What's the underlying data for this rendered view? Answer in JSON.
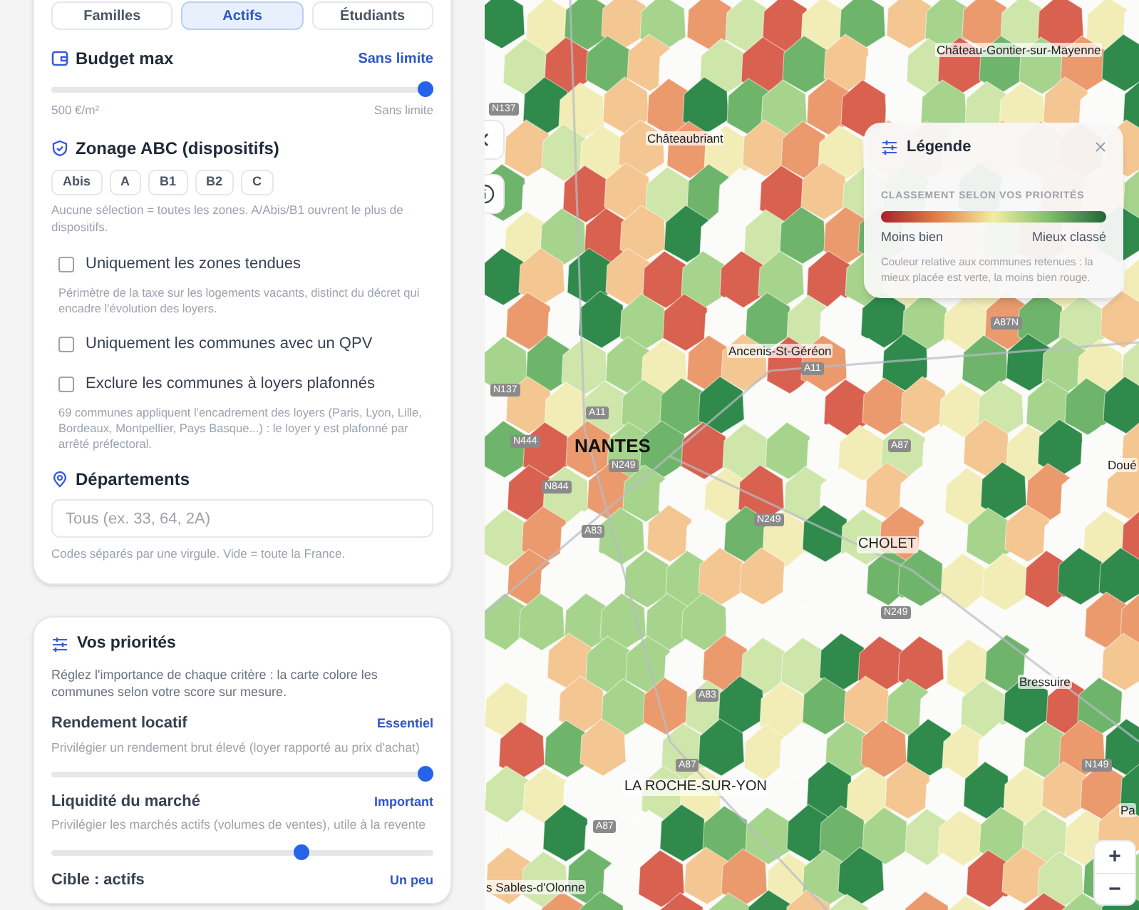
{
  "profile_tabs": [
    {
      "label": "Familles",
      "selected": false
    },
    {
      "label": "Actifs",
      "selected": true
    },
    {
      "label": "Étudiants",
      "selected": false
    }
  ],
  "budget": {
    "title": "Budget max",
    "value": "Sans limite",
    "level": 1,
    "min_label": "500 €/m²",
    "max_label": "Sans limite"
  },
  "zonage": {
    "title": "Zonage ABC (dispositifs)",
    "chips": [
      {
        "label": "Abis",
        "selected": false
      },
      {
        "label": "A",
        "selected": false
      },
      {
        "label": "B1",
        "selected": false
      },
      {
        "label": "B2",
        "selected": false
      },
      {
        "label": "C",
        "selected": false
      }
    ],
    "hint": "Aucune sélection = toutes les zones. A/Abis/B1 ouvrent le plus de dispositifs."
  },
  "filters": [
    {
      "label": "Uniquement les zones tendues",
      "checked": false,
      "hint": "Périmètre de la taxe sur les logements vacants, distinct du décret qui encadre l'évolution des loyers."
    },
    {
      "label": "Uniquement les communes avec un QPV",
      "checked": false
    },
    {
      "label": "Exclure les communes à loyers plafonnés",
      "checked": false,
      "hint": "69 communes appliquent l'encadrement des loyers (Paris, Lyon, Lille, Bordeaux, Montpellier, Pays Basque...) : le loyer y est plafonné par arrêté préfectoral."
    }
  ],
  "departements": {
    "title": "Départements",
    "placeholder": "Tous (ex. 33, 64, 2A)",
    "hint": "Codes séparés par une virgule. Vide = toute la France."
  },
  "priorities": {
    "title": "Vos priorités",
    "intro": "Réglez l'importance de chaque critère : la carte colore les communes selon votre score sur mesure.",
    "criteria": [
      {
        "name": "Rendement locatif",
        "weight": "Essentiel",
        "description": "Privilégier un rendement brut élevé (loyer rapporté au prix d'achat)",
        "level": 1
      },
      {
        "name": "Liquidité du marché",
        "weight": "Important",
        "description": "Privilégier les marchés actifs (volumes de ventes), utile à la revente",
        "level": 0.66
      },
      {
        "name": "Cible : actifs",
        "weight": "Un peu"
      }
    ]
  },
  "legend": {
    "title": "Légende",
    "section": "CLASSEMENT SELON VOS PRIORITÉS",
    "low_label": "Moins bien",
    "high_label": "Mieux classé",
    "note": "Couleur relative aux communes retenues : la mieux placée est verte, la moins bien rouge."
  },
  "map_labels": [
    {
      "text": "Château-Gontier-sur-Mayenne",
      "kind": "town"
    },
    {
      "text": "Châteaubriant",
      "kind": "town"
    },
    {
      "text": "Ancenis-St-Géréon",
      "kind": "town"
    },
    {
      "text": "NANTES",
      "kind": "major"
    },
    {
      "text": "CHOLET",
      "kind": "city"
    },
    {
      "text": "Bressuire",
      "kind": "town"
    },
    {
      "text": "LA ROCHE-SUR-YON",
      "kind": "city"
    },
    {
      "text": "s Sables-d'Olonne",
      "kind": "town"
    },
    {
      "text": "Doué",
      "kind": "town"
    },
    {
      "text": "Pa",
      "kind": "town"
    },
    {
      "text": "N137",
      "kind": "road"
    },
    {
      "text": "A11",
      "kind": "road"
    },
    {
      "text": "N137",
      "kind": "road"
    },
    {
      "text": "A11",
      "kind": "road"
    },
    {
      "text": "N444",
      "kind": "road"
    },
    {
      "text": "N249",
      "kind": "road"
    },
    {
      "text": "N844",
      "kind": "road"
    },
    {
      "text": "A83",
      "kind": "road"
    },
    {
      "text": "N249",
      "kind": "road"
    },
    {
      "text": "N249",
      "kind": "road"
    },
    {
      "text": "A83",
      "kind": "road"
    },
    {
      "text": "A87",
      "kind": "road"
    },
    {
      "text": "A87",
      "kind": "road"
    },
    {
      "text": "N149",
      "kind": "road"
    },
    {
      "text": "A87",
      "kind": "road"
    },
    {
      "text": "A87N",
      "kind": "road"
    }
  ],
  "zoom_controls": [
    "+",
    "−"
  ]
}
